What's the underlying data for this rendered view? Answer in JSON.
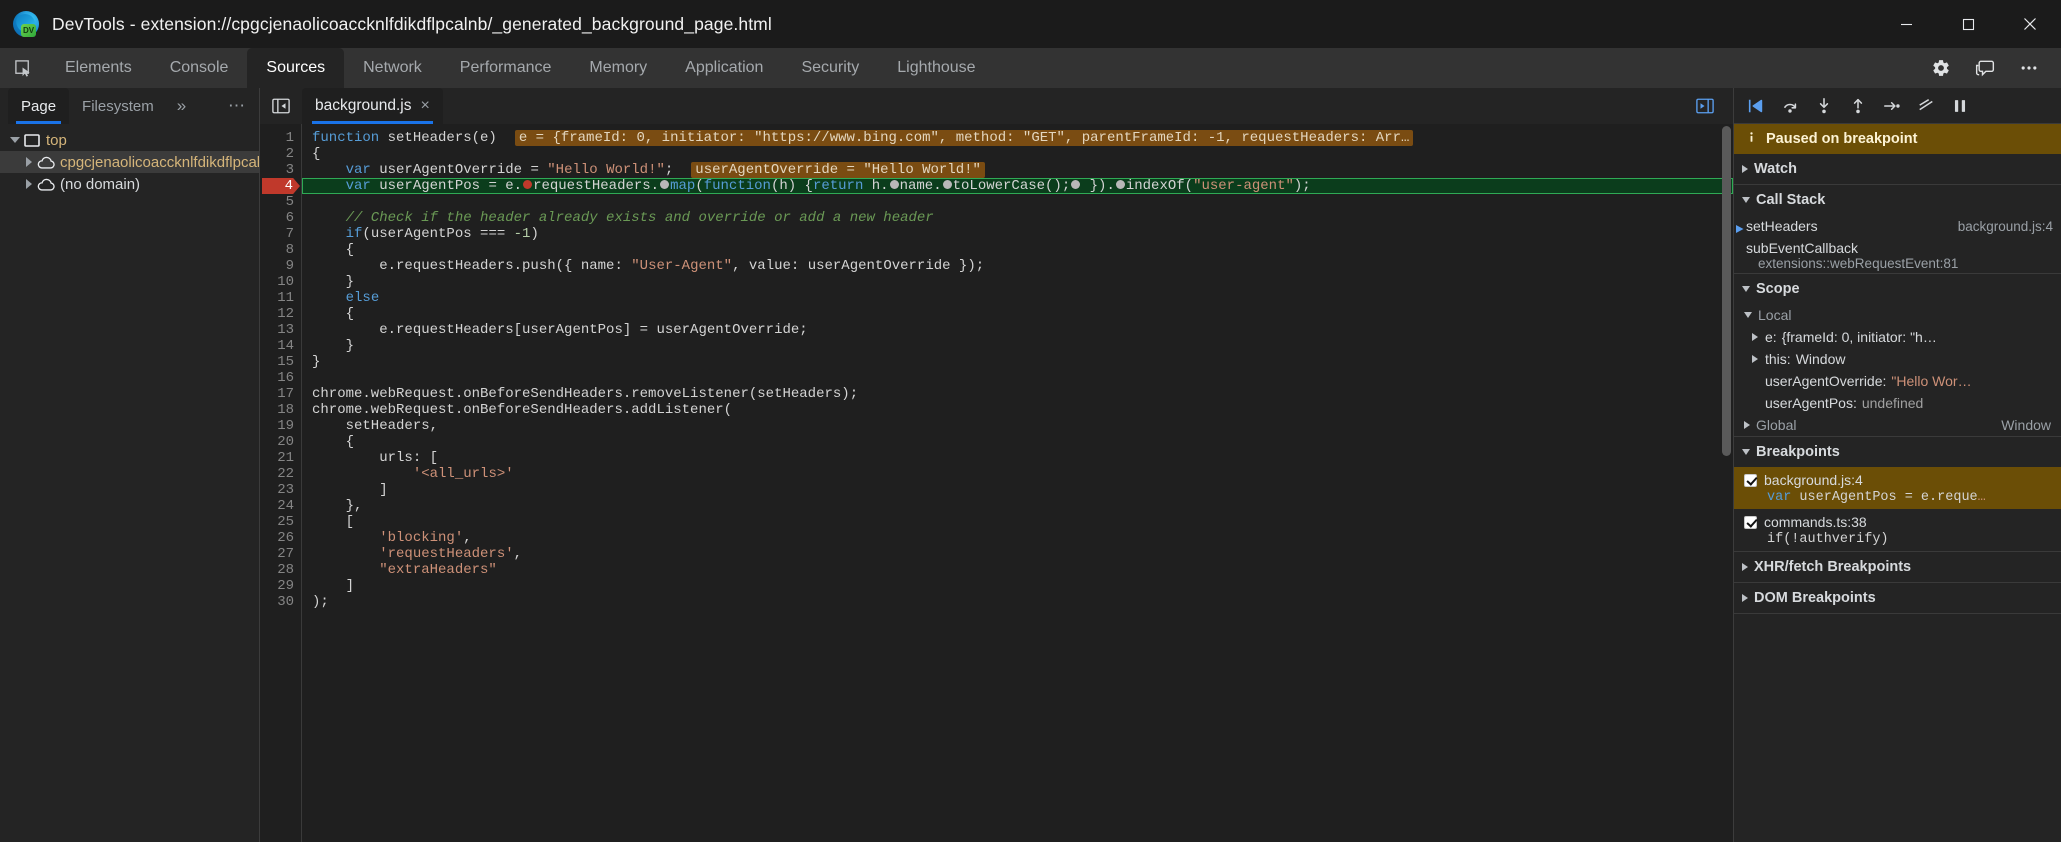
{
  "titlebar": {
    "title": "DevTools - extension://cpgcjenaolicoaccknlfdikdflpcalnb/_generated_background_page.html",
    "logo_badge": "DV",
    "minimize_icon": "minimize-icon",
    "maximize_icon": "maximize-icon",
    "close_icon": "close-icon"
  },
  "main_tabs": {
    "inspect_icon": "inspect-element-icon",
    "items": [
      {
        "label": "Elements",
        "active": false
      },
      {
        "label": "Console",
        "active": false
      },
      {
        "label": "Sources",
        "active": true
      },
      {
        "label": "Network",
        "active": false
      },
      {
        "label": "Performance",
        "active": false
      },
      {
        "label": "Memory",
        "active": false
      },
      {
        "label": "Application",
        "active": false
      },
      {
        "label": "Security",
        "active": false
      },
      {
        "label": "Lighthouse",
        "active": false
      }
    ],
    "settings_icon": "gear-icon",
    "feedback_icon": "feedback-icon",
    "more_icon": "more-vertical-icon"
  },
  "navigator": {
    "tabs": [
      {
        "label": "Page",
        "active": true
      },
      {
        "label": "Filesystem",
        "active": false
      }
    ],
    "overflow_label": "»",
    "more_label": "⋯",
    "tree": [
      {
        "label": "top",
        "icon": "frame-icon",
        "expanded": true,
        "depth": 0,
        "selected": false,
        "color": "orange"
      },
      {
        "label": "cpgcjenaolicoaccknlfdikdflpcalnb",
        "icon": "cloud-icon",
        "expanded": false,
        "depth": 1,
        "selected": true,
        "color": "orange"
      },
      {
        "label": "(no domain)",
        "icon": "cloud-icon",
        "expanded": false,
        "depth": 1,
        "selected": false,
        "color": "plain"
      }
    ]
  },
  "editor": {
    "panel_toggle_icon": "show-navigator-icon",
    "panel_toggle_right_icon": "show-debugger-icon",
    "file_tab": {
      "label": "background.js",
      "close_label": "×"
    },
    "first_line": 1,
    "last_line": 30,
    "breakpoint_line": 4,
    "execution_line": 4,
    "lines": [
      {
        "n": 1,
        "text": "function setHeaders(e)"
      },
      {
        "n": 2,
        "text": "{"
      },
      {
        "n": 3,
        "text": "    var userAgentOverride = \"Hello World!\";"
      },
      {
        "n": 4,
        "text": "    var userAgentPos = e.requestHeaders.map(function(h) {return h.name.toLowerCase(); }).indexOf(\"user-agent\");"
      },
      {
        "n": 5,
        "text": ""
      },
      {
        "n": 6,
        "text": "    // Check if the header already exists and override or add a new header"
      },
      {
        "n": 7,
        "text": "    if(userAgentPos === -1)"
      },
      {
        "n": 8,
        "text": "    {"
      },
      {
        "n": 9,
        "text": "        e.requestHeaders.push({ name: \"User-Agent\", value: userAgentOverride });"
      },
      {
        "n": 10,
        "text": "    }"
      },
      {
        "n": 11,
        "text": "    else"
      },
      {
        "n": 12,
        "text": "    {"
      },
      {
        "n": 13,
        "text": "        e.requestHeaders[userAgentPos] = userAgentOverride;"
      },
      {
        "n": 14,
        "text": "    }"
      },
      {
        "n": 15,
        "text": "}"
      },
      {
        "n": 16,
        "text": ""
      },
      {
        "n": 17,
        "text": "chrome.webRequest.onBeforeSendHeaders.removeListener(setHeaders);"
      },
      {
        "n": 18,
        "text": "chrome.webRequest.onBeforeSendHeaders.addListener("
      },
      {
        "n": 19,
        "text": "    setHeaders,"
      },
      {
        "n": 20,
        "text": "    {"
      },
      {
        "n": 21,
        "text": "        urls: ["
      },
      {
        "n": 22,
        "text": "            '<all_urls>'"
      },
      {
        "n": 23,
        "text": "        ]"
      },
      {
        "n": 24,
        "text": "    },"
      },
      {
        "n": 25,
        "text": "    ["
      },
      {
        "n": 26,
        "text": "        'blocking',"
      },
      {
        "n": 27,
        "text": "        'requestHeaders',"
      },
      {
        "n": 28,
        "text": "        \"extraHeaders\""
      },
      {
        "n": 29,
        "text": "    ]"
      },
      {
        "n": 30,
        "text": ");"
      }
    ],
    "inline_values": {
      "line1": "e = {frameId: 0, initiator: \"https://www.bing.com\", method: \"GET\", parentFrameId: -1, requestHeaders: Arr…",
      "line3": "userAgentOverride = \"Hello World!\""
    }
  },
  "debugger": {
    "toolbar_icons": [
      "resume-script-icon",
      "step-over-icon",
      "step-into-icon",
      "step-out-icon",
      "step-icon",
      "deactivate-breakpoints-icon",
      "pause-on-exceptions-icon"
    ],
    "paused_banner": {
      "icon": "info-icon",
      "text": "Paused on breakpoint"
    },
    "watch": {
      "label": "Watch",
      "expanded": false
    },
    "call_stack": {
      "label": "Call Stack",
      "expanded": true,
      "frames": [
        {
          "name": "setHeaders",
          "location": "background.js:4",
          "current": true
        },
        {
          "name": "subEventCallback",
          "location": "extensions::webRequestEvent:81",
          "current": false
        }
      ]
    },
    "scope": {
      "label": "Scope",
      "expanded": true,
      "local_label": "Local",
      "entries": [
        {
          "name": "e:",
          "value": "{frameId: 0, initiator: \"h…",
          "expandable": true,
          "kind": "object"
        },
        {
          "name": "this:",
          "value": "Window",
          "expandable": true,
          "kind": "object"
        },
        {
          "name": "userAgentOverride:",
          "value": "\"Hello Wor…",
          "expandable": false,
          "kind": "string"
        },
        {
          "name": "userAgentPos:",
          "value": "undefined",
          "expandable": false,
          "kind": "undefined"
        }
      ],
      "global_label": "Global",
      "global_value": "Window"
    },
    "breakpoints": {
      "label": "Breakpoints",
      "expanded": true,
      "items": [
        {
          "checked": true,
          "file": "background.js:4",
          "snippet": "var userAgentPos = e.reque…",
          "highlighted": true
        },
        {
          "checked": true,
          "file": "commands.ts:38",
          "snippet": "if(!authverify)",
          "highlighted": false
        }
      ]
    },
    "xhr_breakpoints": {
      "label": "XHR/fetch Breakpoints",
      "expanded": false
    },
    "dom_breakpoints": {
      "label": "DOM Breakpoints",
      "expanded": false
    }
  },
  "colors": {
    "accent_blue": "#1a73e8",
    "paused_amber": "#6b4e06",
    "exec_green": "#0b3d1c",
    "breakpoint_red": "#c0392b",
    "inline_value_bg": "#7a4c12"
  }
}
